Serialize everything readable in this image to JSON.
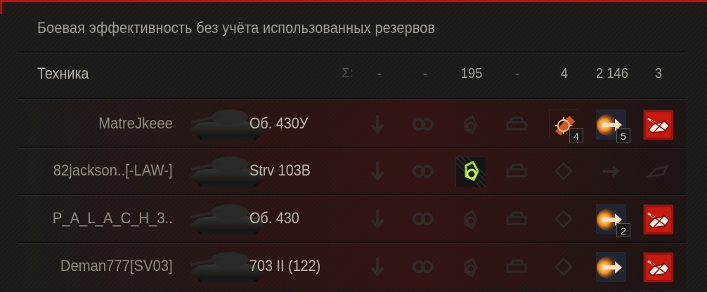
{
  "panel": {
    "title": "Боевая эффективность без учёта использованных резервов",
    "accent_color": "#b01a10"
  },
  "header": {
    "label": "Техника",
    "sigma": "Σ:",
    "totals": [
      "-",
      "-",
      "195",
      "-",
      "4",
      "2 146",
      "3"
    ]
  },
  "columns": [
    {
      "icon": "spotted-icon"
    },
    {
      "icon": "damage-assist-icon"
    },
    {
      "icon": "crits-icon"
    },
    {
      "icon": "tracking-assist-icon"
    },
    {
      "icon": "base-capture-icon"
    },
    {
      "icon": "damage-dealt-icon"
    },
    {
      "icon": "kills-icon"
    }
  ],
  "rows": [
    {
      "player": "MatreJkeee",
      "tank": "Об. 430У",
      "stats": [
        {
          "active": false
        },
        {
          "active": false
        },
        {
          "active": false
        },
        {
          "active": false
        },
        {
          "active": true,
          "kind": "crits",
          "count": "4"
        },
        {
          "active": true,
          "kind": "damage",
          "count": "5"
        },
        {
          "active": true,
          "kind": "kill",
          "count": ""
        }
      ]
    },
    {
      "player": "82jackson..[-LAW-]",
      "tank": "Strv 103B",
      "stats": [
        {
          "active": false
        },
        {
          "active": false
        },
        {
          "active": true,
          "kind": "spot",
          "count": ""
        },
        {
          "active": false
        },
        {
          "active": false
        },
        {
          "active": false
        },
        {
          "active": false
        }
      ]
    },
    {
      "player": "P_A_L_A_C_H_3..",
      "tank": "Об. 430",
      "stats": [
        {
          "active": false
        },
        {
          "active": false
        },
        {
          "active": false
        },
        {
          "active": false
        },
        {
          "active": false
        },
        {
          "active": true,
          "kind": "damage",
          "count": "2"
        },
        {
          "active": true,
          "kind": "kill",
          "count": ""
        }
      ]
    },
    {
      "player": "Deman777[SV03]",
      "tank": "703 II (122)",
      "stats": [
        {
          "active": false
        },
        {
          "active": false
        },
        {
          "active": false
        },
        {
          "active": false
        },
        {
          "active": false
        },
        {
          "active": true,
          "kind": "damage",
          "count": ""
        },
        {
          "active": true,
          "kind": "kill",
          "count": ""
        }
      ]
    }
  ]
}
